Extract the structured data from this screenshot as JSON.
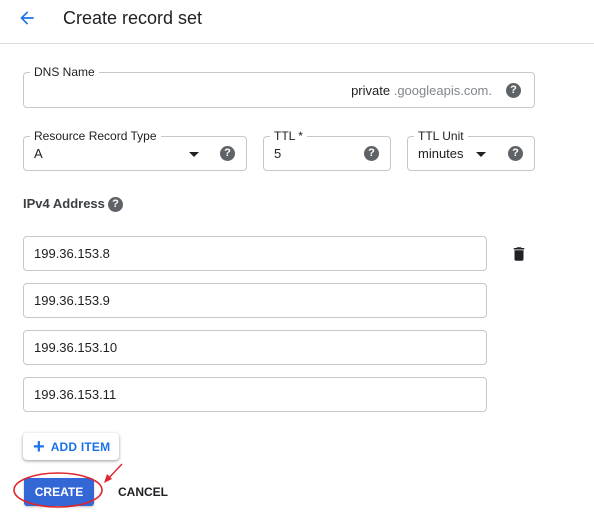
{
  "header": {
    "title": "Create record set",
    "back_icon": "arrow-back-icon"
  },
  "dns_name": {
    "label": "DNS Name",
    "value": "private",
    "suffix": ".googleapis.com."
  },
  "resource_record_type": {
    "label": "Resource Record Type",
    "value": "A"
  },
  "ttl": {
    "label": "TTL *",
    "value": "5"
  },
  "ttl_unit": {
    "label": "TTL Unit",
    "value": "minutes"
  },
  "ipv4": {
    "label": "IPv4 Address",
    "addresses": [
      "199.36.153.8",
      "199.36.153.9",
      "199.36.153.10",
      "199.36.153.11"
    ]
  },
  "actions": {
    "add_item_label": "ADD ITEM",
    "create_label": "CREATE",
    "cancel_label": "CANCEL"
  },
  "icons": {
    "help": "help-icon",
    "trash": "trash-icon",
    "dropdown": "chevron-down-icon",
    "add": "plus-icon"
  },
  "colors": {
    "primary": "#3367d6",
    "link": "#1a73e8",
    "annotation": "#e0242b"
  }
}
